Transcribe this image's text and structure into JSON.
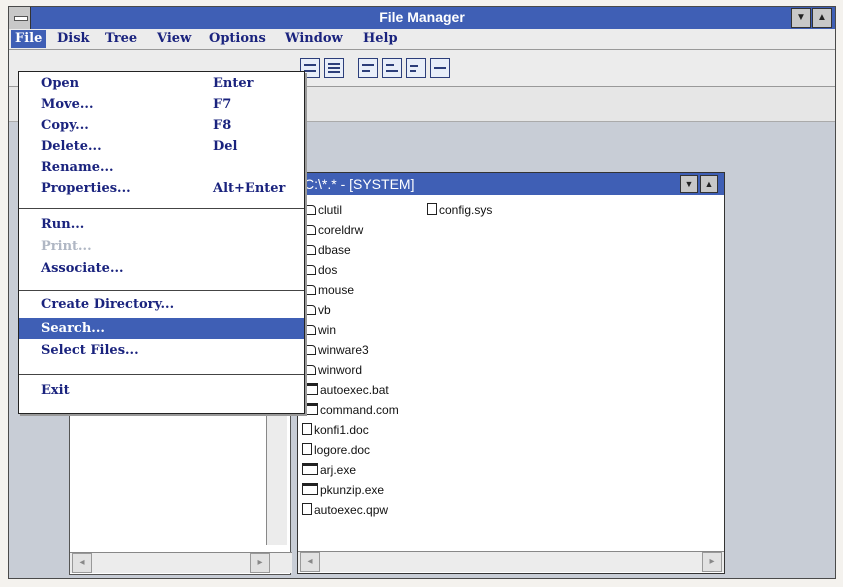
{
  "window": {
    "title": "File Manager"
  },
  "menubar": [
    {
      "label": "File",
      "active": true
    },
    {
      "label": "Disk"
    },
    {
      "label": "Tree"
    },
    {
      "label": "View"
    },
    {
      "label": "Options"
    },
    {
      "label": "Window"
    },
    {
      "label": "Help"
    }
  ],
  "file_menu": {
    "open": {
      "label": "Open",
      "shortcut": "Enter"
    },
    "move": {
      "label": "Move...",
      "shortcut": "F7"
    },
    "copy": {
      "label": "Copy...",
      "shortcut": "F8"
    },
    "delete": {
      "label": "Delete...",
      "shortcut": "Del"
    },
    "rename": {
      "label": "Rename..."
    },
    "properties": {
      "label": "Properties...",
      "shortcut": "Alt+Enter"
    },
    "run": {
      "label": "Run..."
    },
    "print": {
      "label": "Print..."
    },
    "associate": {
      "label": "Associate..."
    },
    "create_directory": {
      "label": "Create Directory..."
    },
    "search": {
      "label": "Search..."
    },
    "select_files": {
      "label": "Select Files..."
    },
    "exit": {
      "label": "Exit"
    }
  },
  "directory_window": {
    "title": "C:\\*.* - [SYSTEM]",
    "files_col1": [
      {
        "name": "clutil",
        "type": "folder"
      },
      {
        "name": "coreldrw",
        "type": "folder"
      },
      {
        "name": "dbase",
        "type": "folder"
      },
      {
        "name": "dos",
        "type": "folder"
      },
      {
        "name": "mouse",
        "type": "folder"
      },
      {
        "name": "vb",
        "type": "folder"
      },
      {
        "name": "win",
        "type": "folder"
      },
      {
        "name": "winware3",
        "type": "folder"
      },
      {
        "name": "winword",
        "type": "folder"
      },
      {
        "name": "autoexec.bat",
        "type": "exe"
      },
      {
        "name": "command.com",
        "type": "exe"
      },
      {
        "name": "konfi1.doc",
        "type": "doc"
      },
      {
        "name": "logore.doc",
        "type": "doc"
      },
      {
        "name": "arj.exe",
        "type": "exe"
      },
      {
        "name": "pkunzip.exe",
        "type": "exe"
      },
      {
        "name": "autoexec.qpw",
        "type": "doc"
      }
    ],
    "files_col2": [
      {
        "name": "config.sys",
        "type": "doc"
      }
    ]
  },
  "icons": {
    "control_menu": "control-menu-icon",
    "minimize": "minimize-icon",
    "maximize": "maximize-icon",
    "scroll_left": "scroll-left-icon",
    "scroll_right": "scroll-right-icon",
    "scroll_up": "scroll-up-icon",
    "scroll_down": "scroll-down-icon",
    "toolbar_tools": [
      "view-large-icon",
      "view-details-icon",
      "sort-by-name-icon",
      "sort-by-type-icon",
      "search-files-icon",
      "directory-only-icon"
    ]
  },
  "colors": {
    "titlebar": "#3f5fb5",
    "menu_text": "#1a237e",
    "selection": "#3f5fb5",
    "disabled": "#b0b7c4"
  }
}
